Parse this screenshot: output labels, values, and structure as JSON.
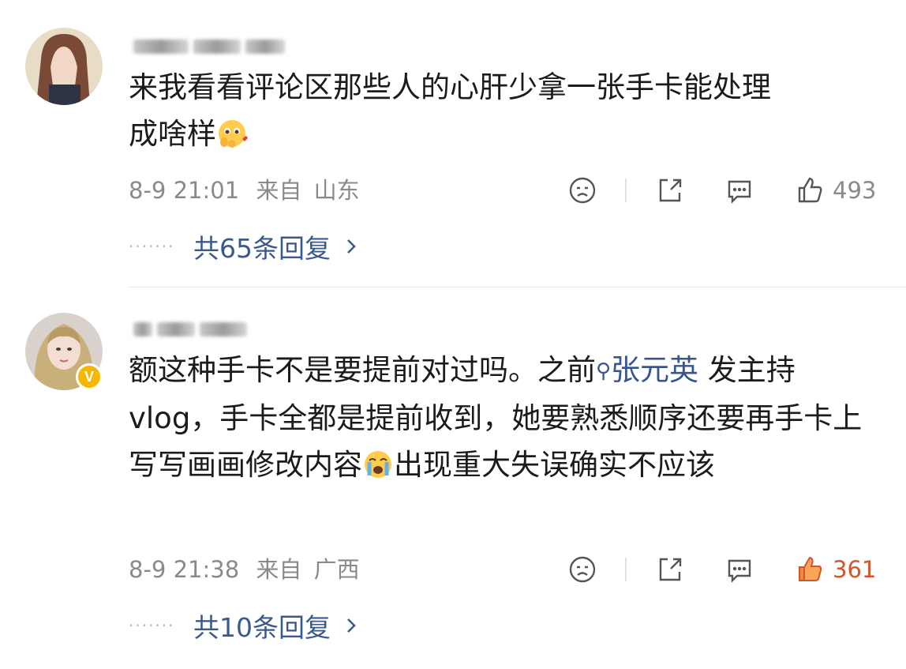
{
  "comments": [
    {
      "username": "",
      "verified": false,
      "text_lines": [
        "来我看看评论区那些人的心肝少拿一张手卡能处理",
        "成啥样"
      ],
      "emoji": "pleading-hands-emoji",
      "timestamp": "8-9 21:01",
      "location_prefix": "来自",
      "location": "山东",
      "likes": "493",
      "liked": false,
      "replies_label": "共65条回复"
    },
    {
      "username": "",
      "verified": true,
      "verified_badge": "V",
      "text_pre_mention": "额这种手卡不是要提前对过吗。之前",
      "mention": "张元英",
      "text_post_mention": " 发主持vlog，手卡全都是提前收到，她要熟悉顺序还要再手卡上写写画画修改内容",
      "emoji": "crying-emoji",
      "text_after_emoji": "出现重大失误确实不应该",
      "timestamp": "8-9 21:38",
      "location_prefix": "来自",
      "location": "广西",
      "likes": "361",
      "liked": true,
      "replies_label": "共10条回复"
    }
  ],
  "icons": {
    "dislike": "dislike-face-icon",
    "share": "share-icon",
    "comment": "comment-icon",
    "like": "thumbs-up-icon",
    "reply_dots": "ellipsis-dots",
    "chevron": "chevron-right-icon"
  },
  "colors": {
    "mention": "#37568f",
    "reply_link": "#3a5a8e",
    "liked": "#d2562b",
    "meta": "#8a8a8a",
    "verified": "#f5b800"
  }
}
